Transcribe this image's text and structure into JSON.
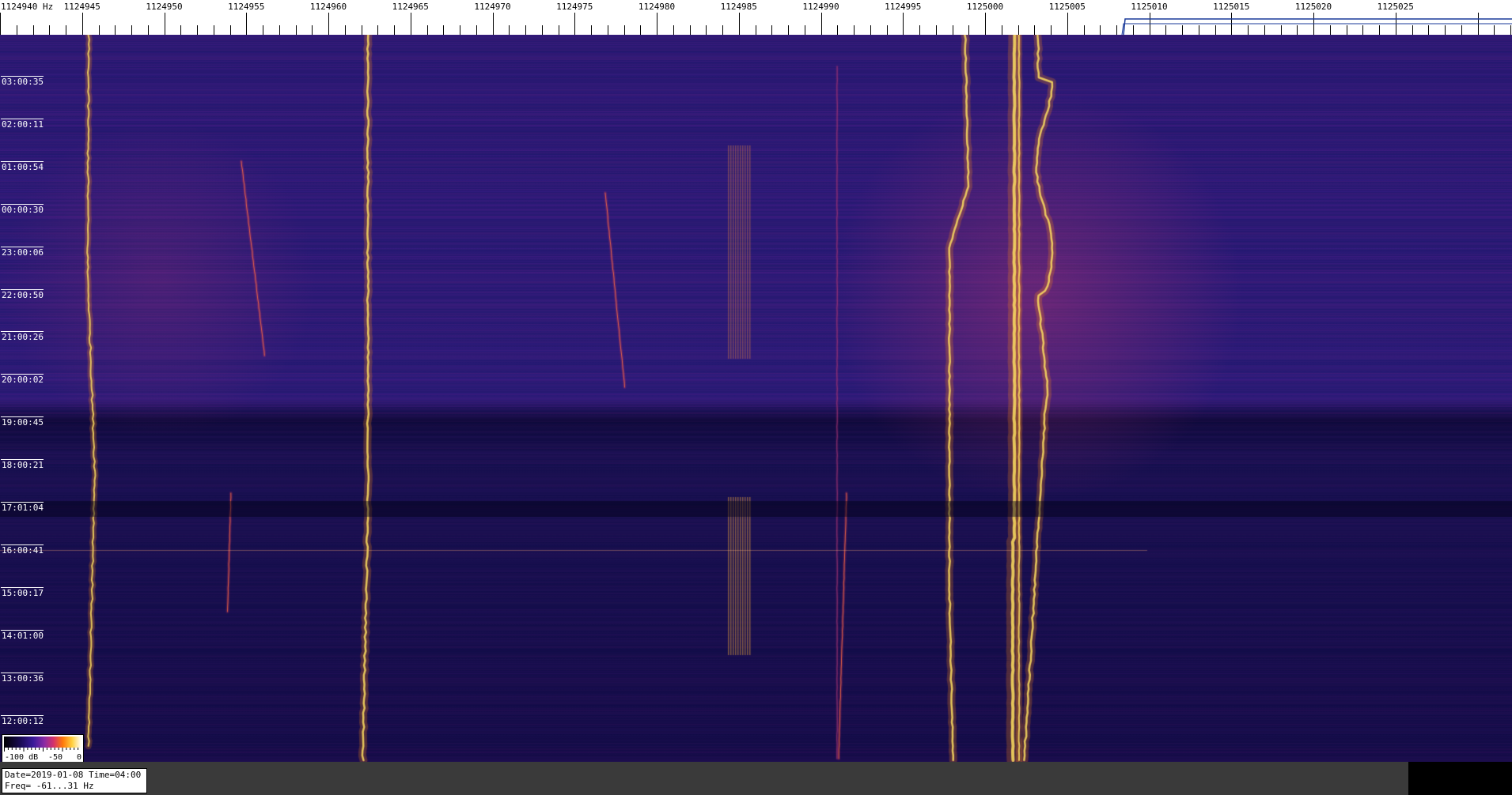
{
  "freq_axis": {
    "first_label": "1124940 Hz",
    "labels": [
      "1124945",
      "1124950",
      "1124955",
      "1124960",
      "1124965",
      "1124970",
      "1124975",
      "1124980",
      "1124985",
      "1124990",
      "1124995",
      "1125000",
      "1125005",
      "1125010",
      "1125015",
      "1125020",
      "1125025"
    ]
  },
  "time_axis": {
    "labels": [
      "03:00:35",
      "02:00:11",
      "01:00:54",
      "00:00:30",
      "23:00:06",
      "22:00:50",
      "21:00:26",
      "20:00:02",
      "19:00:45",
      "18:00:21",
      "17:01:04",
      "16:00:41",
      "15:00:17",
      "14:01:00",
      "13:00:36",
      "12:00:12"
    ]
  },
  "colorbar": {
    "labels": [
      "-100 dB",
      "-50",
      "0"
    ]
  },
  "info": {
    "line1": "Date=2019-01-08 Time=04:00",
    "line2": "Freq= -61...31 Hz"
  },
  "colors": {
    "background": "#1a1560",
    "trace_core": "#ffe060",
    "trace_glow": "#ff8a10"
  }
}
